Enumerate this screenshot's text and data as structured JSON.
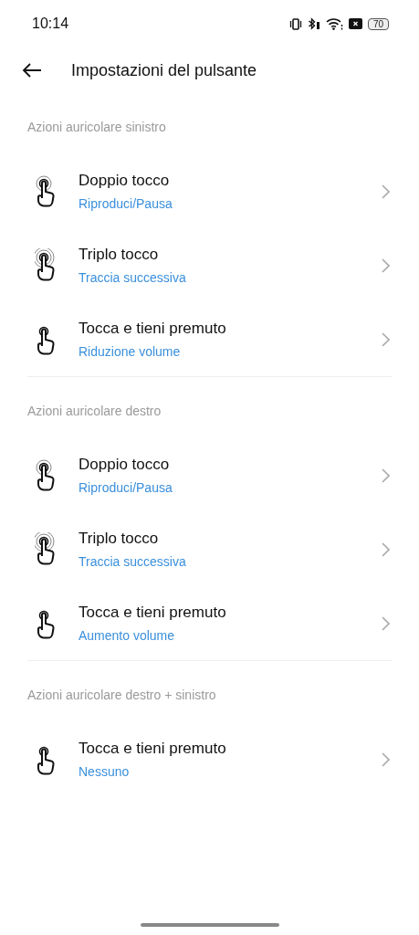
{
  "status_bar": {
    "time": "10:14",
    "battery": "70"
  },
  "header": {
    "title": "Impostazioni del pulsante"
  },
  "sections": [
    {
      "title": "Azioni auricolare sinistro",
      "items": [
        {
          "kind": "double",
          "label": "Doppio tocco",
          "value": "Riproduci/Pausa"
        },
        {
          "kind": "triple",
          "label": "Triplo tocco",
          "value": "Traccia successiva"
        },
        {
          "kind": "hold",
          "label": "Tocca e tieni premuto",
          "value": "Riduzione volume"
        }
      ]
    },
    {
      "title": "Azioni auricolare destro",
      "items": [
        {
          "kind": "double",
          "label": "Doppio tocco",
          "value": "Riproduci/Pausa"
        },
        {
          "kind": "triple",
          "label": "Triplo tocco",
          "value": "Traccia successiva"
        },
        {
          "kind": "hold",
          "label": "Tocca e tieni premuto",
          "value": "Aumento volume"
        }
      ]
    },
    {
      "title": "Azioni auricolare destro + sinistro",
      "items": [
        {
          "kind": "hold",
          "label": "Tocca e tieni premuto",
          "value": "Nessuno"
        }
      ]
    }
  ]
}
